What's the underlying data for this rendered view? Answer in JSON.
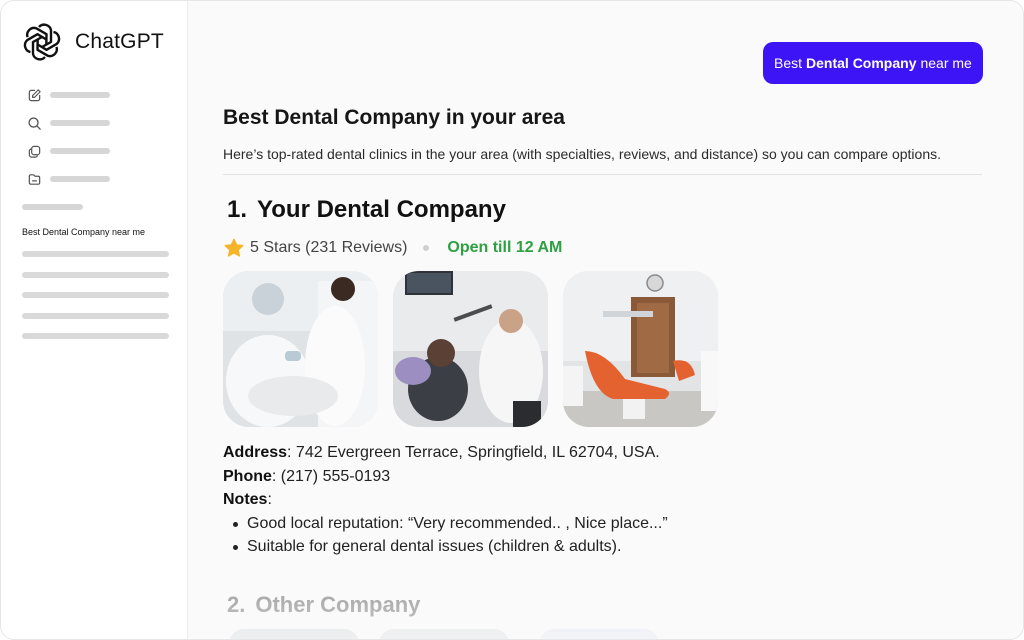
{
  "app": {
    "name": "ChatGPT"
  },
  "sidebar": {
    "nav_icons": [
      "new-chat-icon",
      "search-icon",
      "library-icon",
      "projects-folder-icon"
    ],
    "active_chat": "Best Dental Company near me"
  },
  "query": {
    "prefix": "Best",
    "bold": "Dental Company",
    "suffix": "near me"
  },
  "response": {
    "title": "Best Dental Company in your area",
    "intro": "Here’s top-rated dental clinics in the your area (with specialties, reviews, and distance) so you can compare options.",
    "results": [
      {
        "number": "1.",
        "name": "Your Dental Company",
        "rating": "5 Stars (231 Reviews)",
        "status": "Open till 12 AM",
        "status_color": "#2ea043",
        "address_label": "Address",
        "address": ": 742 Evergreen Terrace, Springfield, IL 62704, USA.",
        "phone_label": "Phone",
        "phone": ": (217) 555-0193",
        "notes_label": "Notes",
        "notes_colon": ":",
        "notes": [
          "Good local reputation: “Very recommended.. , Nice place...”",
          "Suitable for general dental issues (children & adults)."
        ]
      },
      {
        "number": "2.",
        "name": "Other Company"
      }
    ]
  },
  "colors": {
    "accent": "#3d14f5",
    "star": "#f5b42a"
  }
}
